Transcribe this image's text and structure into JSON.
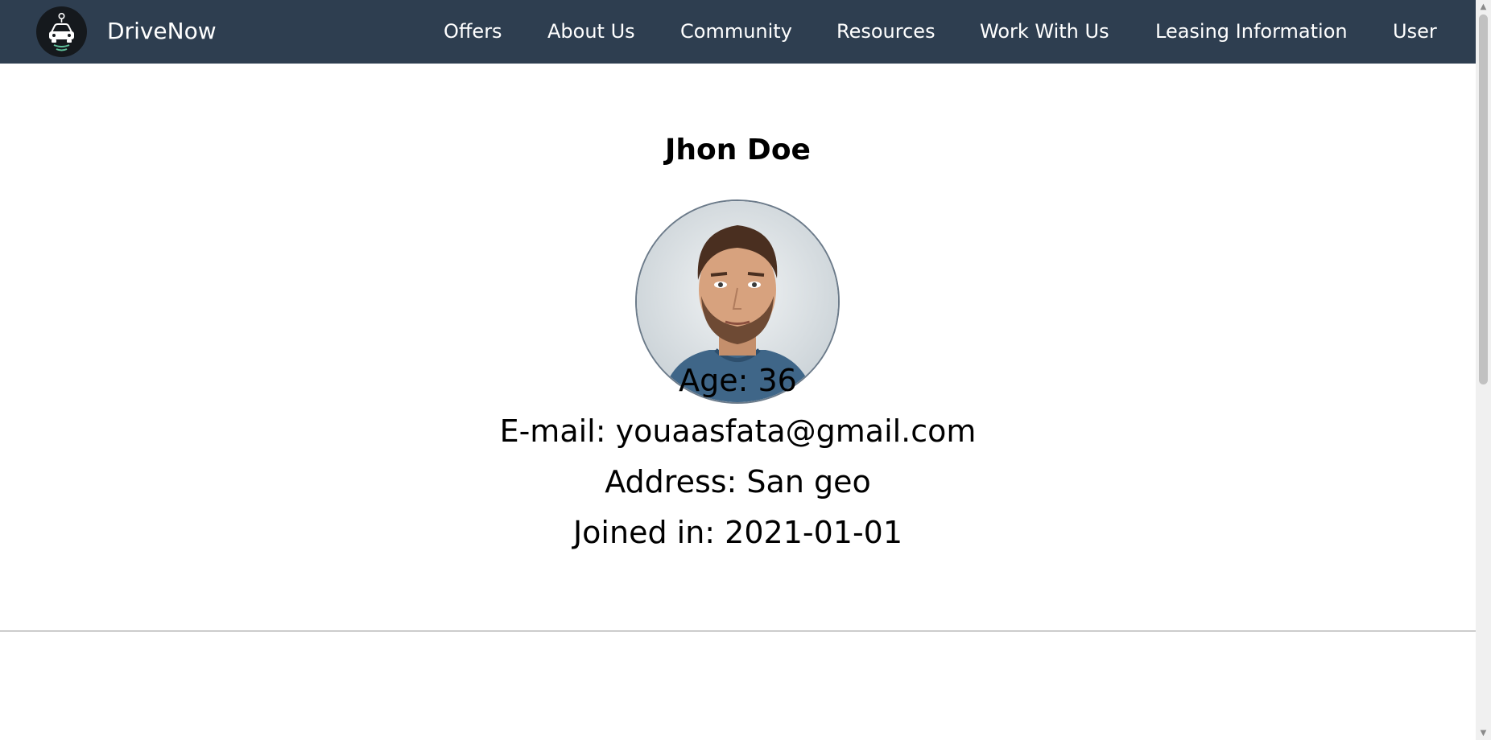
{
  "app": {
    "brand_name": "DriveNow",
    "logo_icon": "car-logo-icon"
  },
  "nav": {
    "items": [
      {
        "label": "Offers"
      },
      {
        "label": "About Us"
      },
      {
        "label": "Community"
      },
      {
        "label": "Resources"
      },
      {
        "label": "Work With Us"
      },
      {
        "label": "Leasing Information"
      },
      {
        "label": "User"
      }
    ]
  },
  "profile": {
    "name": "Jhon Doe",
    "avatar_icon": "user-avatar",
    "age_line": "Age: 36",
    "email_line": "E-mail: youaasfata@gmail.com",
    "address_line": "Address: San geo",
    "joined_line": "Joined in: 2021-01-01"
  },
  "colors": {
    "navbar_bg": "#2e3e50",
    "nav_text": "#ffffff",
    "page_bg": "#ffffff",
    "avatar_border": "#6c7b8a"
  }
}
